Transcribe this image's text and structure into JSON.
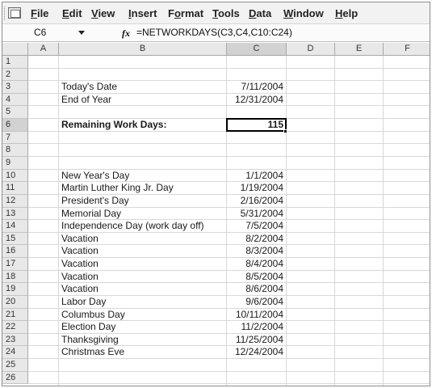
{
  "menu": {
    "items": [
      {
        "label": "File",
        "u": "F",
        "rest": "ile"
      },
      {
        "label": "Edit",
        "u": "E",
        "rest": "dit"
      },
      {
        "label": "View",
        "u": "V",
        "rest": "iew"
      },
      {
        "label": "Insert",
        "u": "I",
        "rest": "nsert"
      },
      {
        "label": "Format",
        "pre": "F",
        "u": "o",
        "rest": "rmat"
      },
      {
        "label": "Tools",
        "u": "T",
        "rest": "ools"
      },
      {
        "label": "Data",
        "u": "D",
        "rest": "ata"
      },
      {
        "label": "Window",
        "u": "W",
        "rest": "indow"
      },
      {
        "label": "Help",
        "u": "H",
        "rest": "elp"
      }
    ]
  },
  "formula_bar": {
    "name_box": "C6",
    "fx_label": "fx",
    "formula": "=NETWORKDAYS(C3,C4,C10:C24)"
  },
  "columns": [
    "A",
    "B",
    "C",
    "D",
    "E",
    "F"
  ],
  "selected_column": "C",
  "rows": [
    "1",
    "2",
    "3",
    "4",
    "5",
    "6",
    "7",
    "8",
    "9",
    "10",
    "11",
    "12",
    "13",
    "14",
    "15",
    "16",
    "17",
    "18",
    "19",
    "20",
    "21",
    "22",
    "23",
    "24",
    "25",
    "26"
  ],
  "selected_row": "6",
  "cells": {
    "B3": "Today's Date",
    "C3": "7/11/2004",
    "B4": "End of Year",
    "C4": "12/31/2004",
    "B6": "Remaining Work Days:",
    "C6": "115",
    "B10": "New Year's Day",
    "C10": "1/1/2004",
    "B11": "Martin Luther King Jr. Day",
    "C11": "1/19/2004",
    "B12": "President's Day",
    "C12": "2/16/2004",
    "B13": "Memorial Day",
    "C13": "5/31/2004",
    "B14": "Independence Day (work day off)",
    "C14": "7/5/2004",
    "B15": "Vacation",
    "C15": "8/2/2004",
    "B16": "Vacation",
    "C16": "8/3/2004",
    "B17": "Vacation",
    "C17": "8/4/2004",
    "B18": "Vacation",
    "C18": "8/5/2004",
    "B19": "Vacation",
    "C19": "8/6/2004",
    "B20": "Labor Day",
    "C20": "9/6/2004",
    "B21": "Columbus Day",
    "C21": "10/11/2004",
    "B22": "Election Day",
    "C22": "11/2/2004",
    "B23": "Thanksgiving",
    "C23": "11/25/2004",
    "B24": "Christmas Eve",
    "C24": "12/24/2004"
  }
}
